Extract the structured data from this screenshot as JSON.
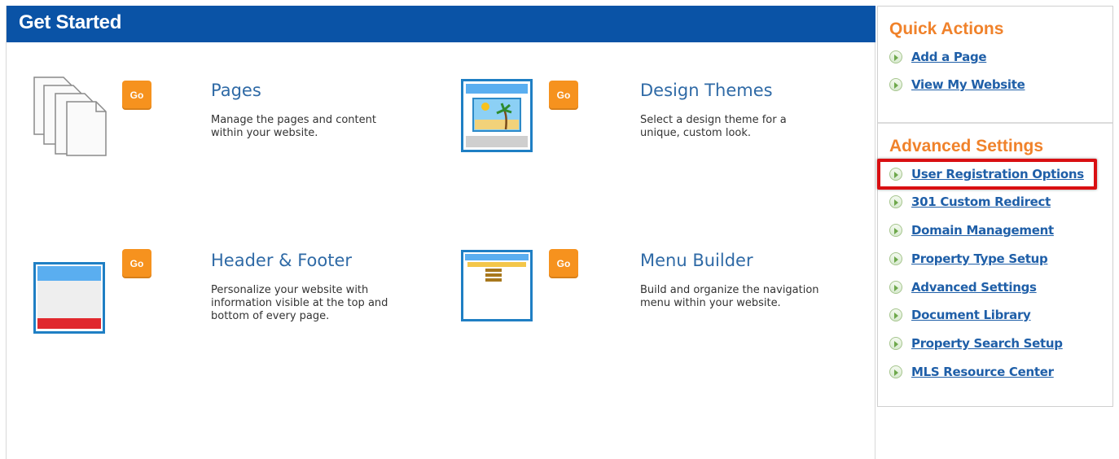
{
  "main": {
    "title": "Get Started",
    "cards": [
      {
        "name": "pages",
        "go_label": "Go",
        "title": "Pages",
        "description": "Manage the pages and content within your website."
      },
      {
        "name": "design-themes",
        "go_label": "Go",
        "title": "Design Themes",
        "description": "Select a design theme for a unique, custom look."
      },
      {
        "name": "header-footer",
        "go_label": "Go",
        "title": "Header & Footer",
        "description": "Personalize your website with information visible at the top and bottom of every page."
      },
      {
        "name": "menu-builder",
        "go_label": "Go",
        "title": "Menu Builder",
        "description": "Build and organize the navigation menu within your website."
      }
    ]
  },
  "sidebar": {
    "quick_actions": {
      "heading": "Quick Actions",
      "links": [
        "Add a Page",
        "View My Website"
      ]
    },
    "advanced_settings": {
      "heading": "Advanced Settings",
      "links": [
        "User Registration Options",
        "301 Custom Redirect",
        "Domain Management",
        "Property Type Setup",
        "Advanced Settings",
        "Document Library",
        "Property Search Setup",
        "MLS Resource Center"
      ]
    }
  },
  "colors": {
    "header_blue": "#0a53a6",
    "go_orange": "#f6921e",
    "heading_orange": "#f0822b",
    "link_blue": "#1f5fa8",
    "highlight_red": "#d90f12"
  }
}
